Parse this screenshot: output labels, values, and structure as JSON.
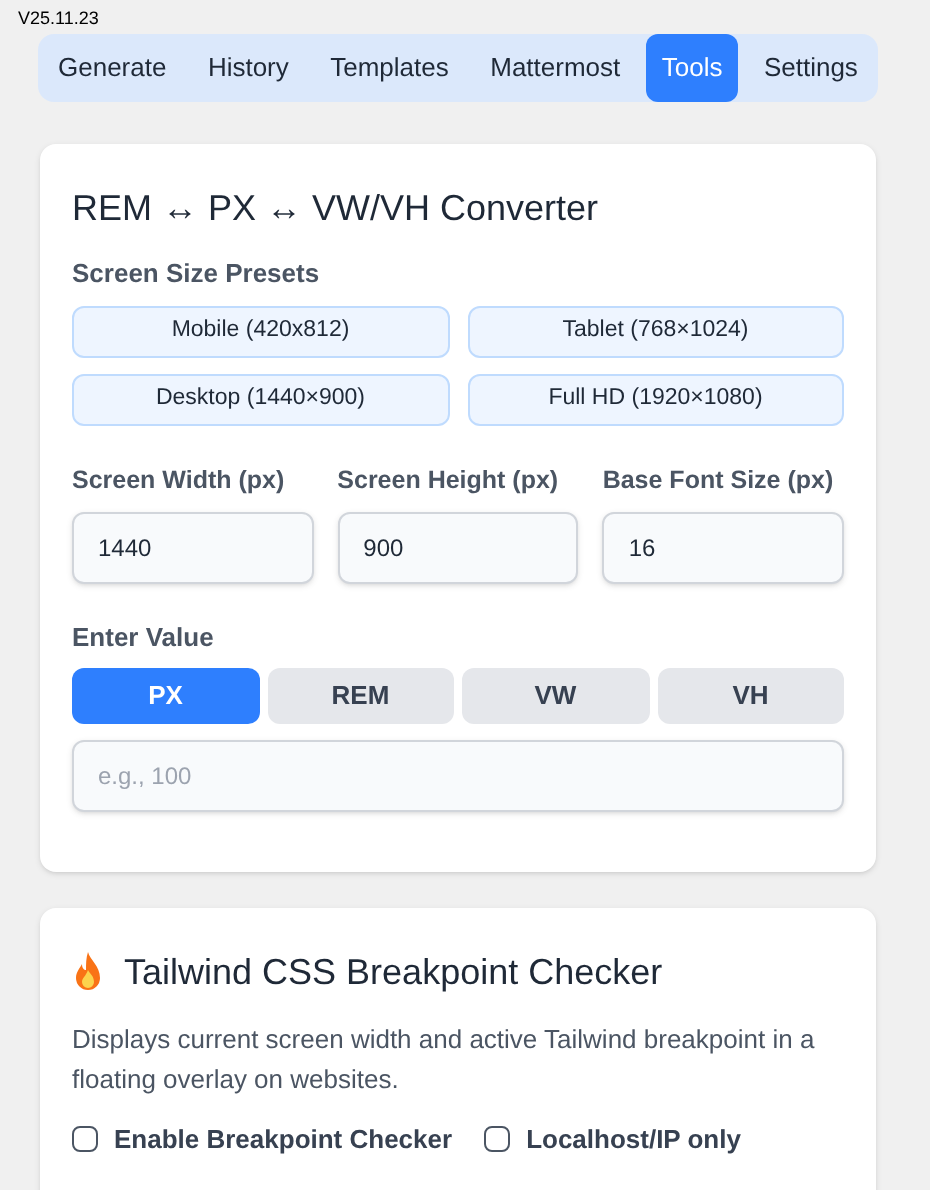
{
  "version": "V25.11.23",
  "tabs": [
    {
      "label": "Generate",
      "selected": false
    },
    {
      "label": "History",
      "selected": false
    },
    {
      "label": "Templates",
      "selected": false
    },
    {
      "label": "Mattermost",
      "selected": false
    },
    {
      "label": "Tools",
      "selected": true
    },
    {
      "label": "Settings",
      "selected": false
    }
  ],
  "converter": {
    "title": "REM ↔ PX ↔ VW/VH Converter",
    "presets_label": "Screen Size Presets",
    "presets": [
      "Mobile (420x812)",
      "Tablet (768×1024)",
      "Desktop (1440×900)",
      "Full HD (1920×1080)"
    ],
    "fields": [
      {
        "label": "Screen Width (px)",
        "value": "1440"
      },
      {
        "label": "Screen Height (px)",
        "value": "900"
      },
      {
        "label": "Base Font Size (px)",
        "value": "16"
      }
    ],
    "value_label": "Enter Value",
    "units": [
      {
        "label": "PX",
        "selected": true
      },
      {
        "label": "REM",
        "selected": false
      },
      {
        "label": "VW",
        "selected": false
      },
      {
        "label": "VH",
        "selected": false
      }
    ],
    "value_placeholder": "e.g., 100"
  },
  "breakpoint": {
    "title": "Tailwind CSS Breakpoint Checker",
    "description": "Displays current screen width and active Tailwind breakpoint in a floating overlay on websites.",
    "options": [
      {
        "label": "Enable Breakpoint Checker",
        "checked": false
      },
      {
        "label": "Localhost/IP only",
        "checked": false
      }
    ]
  }
}
